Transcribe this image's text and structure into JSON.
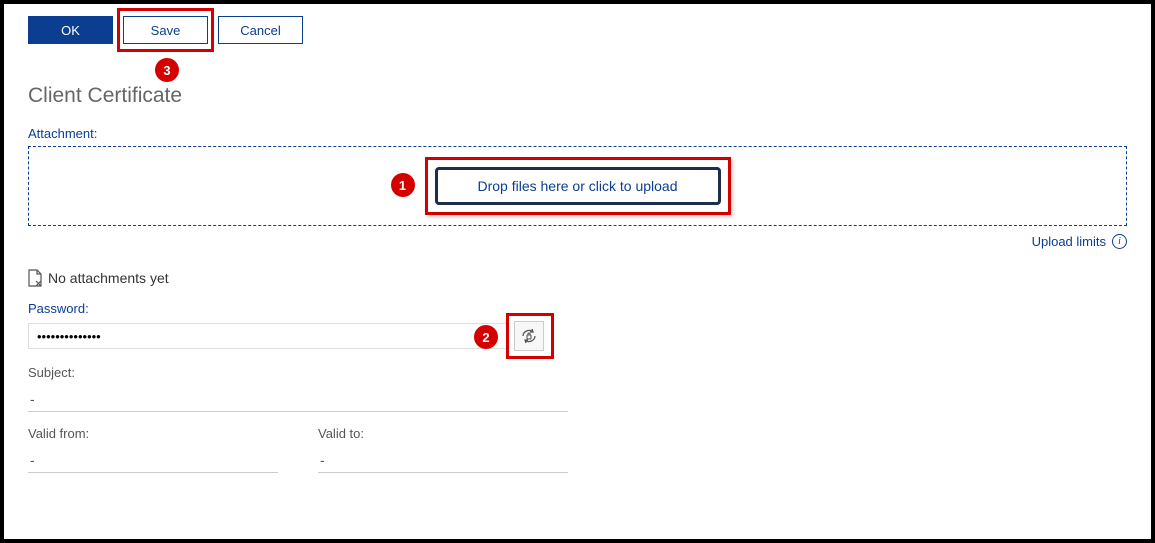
{
  "toolbar": {
    "ok_label": "OK",
    "save_label": "Save",
    "cancel_label": "Cancel"
  },
  "section_title": "Client Certificate",
  "attachment_label": "Attachment:",
  "dropzone_text": "Drop files here or click to upload",
  "upload_limits_label": "Upload limits",
  "no_attachments_text": "No attachments yet",
  "password_label": "Password:",
  "password_value": "••••••••••••••",
  "subject_label": "Subject:",
  "subject_value": "-",
  "valid_from_label": "Valid from:",
  "valid_from_value": "-",
  "valid_to_label": "Valid to:",
  "valid_to_value": "-",
  "annotations": {
    "n1": "1",
    "n2": "2",
    "n3": "3"
  }
}
